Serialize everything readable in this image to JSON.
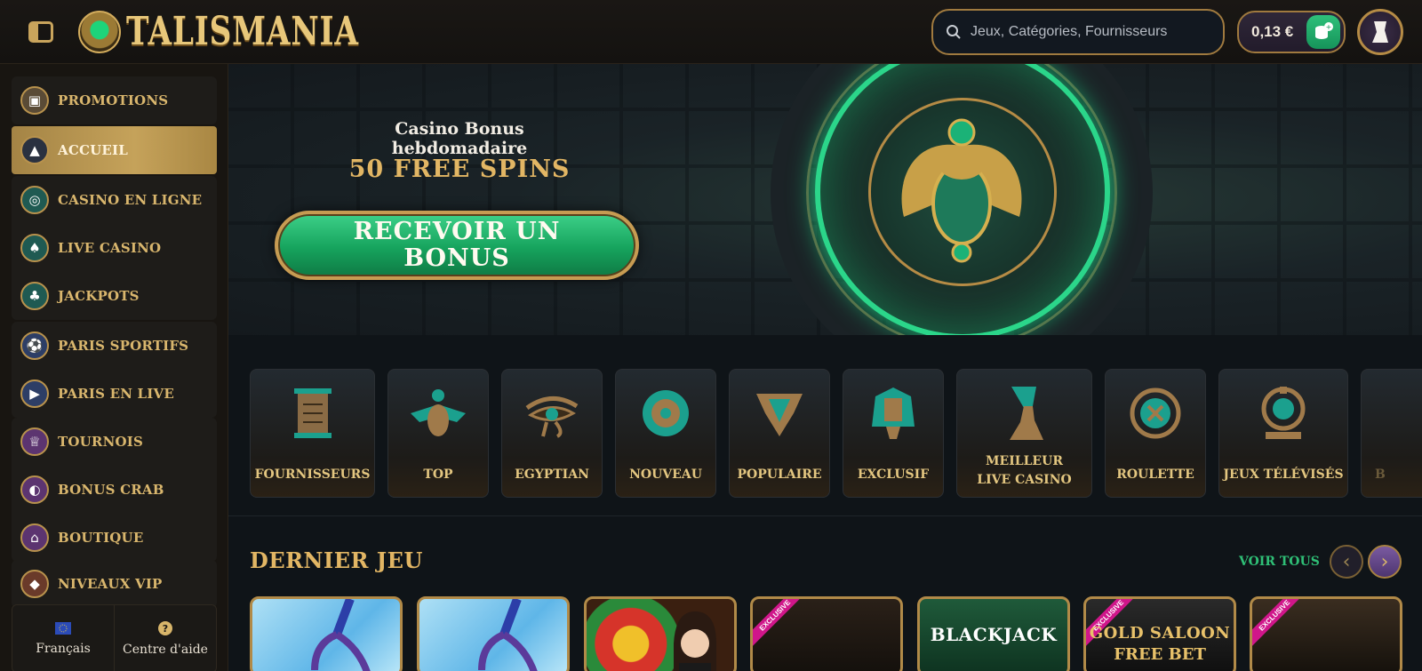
{
  "header": {
    "logo_text": "TALISMANIA",
    "search_placeholder": "Jeux, Catégories, Fournisseurs",
    "balance": "0,13 €"
  },
  "sidebar": {
    "groups": [
      [
        {
          "label": "PROMOTIONS",
          "icon": "treasure-chest-icon",
          "active": false
        }
      ],
      [
        {
          "label": "ACCUEIL",
          "icon": "pyramid-icon",
          "active": true
        }
      ],
      [
        {
          "label": "CASINO EN LIGNE",
          "icon": "chip-icon",
          "active": false
        },
        {
          "label": "LIVE CASINO",
          "icon": "spade-icon",
          "active": false
        },
        {
          "label": "JACKPOTS",
          "icon": "clover-icon",
          "active": false
        }
      ],
      [
        {
          "label": "PARIS SPORTIFS",
          "icon": "soccer-ball-icon",
          "active": false
        },
        {
          "label": "PARIS EN LIVE",
          "icon": "play-icon",
          "active": false
        }
      ],
      [
        {
          "label": "TOURNOIS",
          "icon": "trophy-icon",
          "active": false
        },
        {
          "label": "BONUS CRAB",
          "icon": "crab-icon",
          "active": false
        },
        {
          "label": "BOUTIQUE",
          "icon": "temple-icon",
          "active": false
        }
      ],
      [
        {
          "label": "NIVEAUX VIP",
          "icon": "diamond-icon",
          "active": false
        }
      ]
    ],
    "footer": {
      "language": "Français",
      "help": "Centre d'aide"
    }
  },
  "banner": {
    "subtitle": "Casino Bonus hebdomadaire",
    "title": "50 FREE SPINS",
    "cta": "RECEVOIR UN BONUS"
  },
  "categories": [
    {
      "label": "FOURNISSEURS",
      "icon": "scroll-icon"
    },
    {
      "label": "TOP",
      "icon": "scarab-icon"
    },
    {
      "label": "EGYPTIAN",
      "icon": "eye-of-horus-icon"
    },
    {
      "label": "NOUVEAU",
      "icon": "sun-compass-icon"
    },
    {
      "label": "POPULAIRE",
      "icon": "ornament-icon"
    },
    {
      "label": "EXCLUSIF",
      "icon": "pharaoh-icon"
    },
    {
      "label": "MEILLEUR LIVE CASINO",
      "icon": "nefertiti-icon"
    },
    {
      "label": "ROULETTE",
      "icon": "roulette-icon"
    },
    {
      "label": "JEUX TÉLÉVISÉS",
      "icon": "wheel-icon"
    },
    {
      "label": "B",
      "icon": ""
    }
  ],
  "latest": {
    "title": "DERNIER JEU",
    "see_all": "VOIR TOUS",
    "games": [
      {
        "label": "",
        "sub": "",
        "exclusive": false
      },
      {
        "label": "",
        "sub": "",
        "exclusive": false
      },
      {
        "label": "",
        "sub": "",
        "exclusive": false
      },
      {
        "label": "",
        "sub": "",
        "exclusive": true
      },
      {
        "label": "BLACKJACK",
        "sub": "",
        "exclusive": false
      },
      {
        "label": "GOLD SALOON",
        "sub": "FREE BET",
        "exclusive": true
      },
      {
        "label": "",
        "sub": "",
        "exclusive": true
      }
    ],
    "exclusive_label": "EXCLUSIVE"
  }
}
